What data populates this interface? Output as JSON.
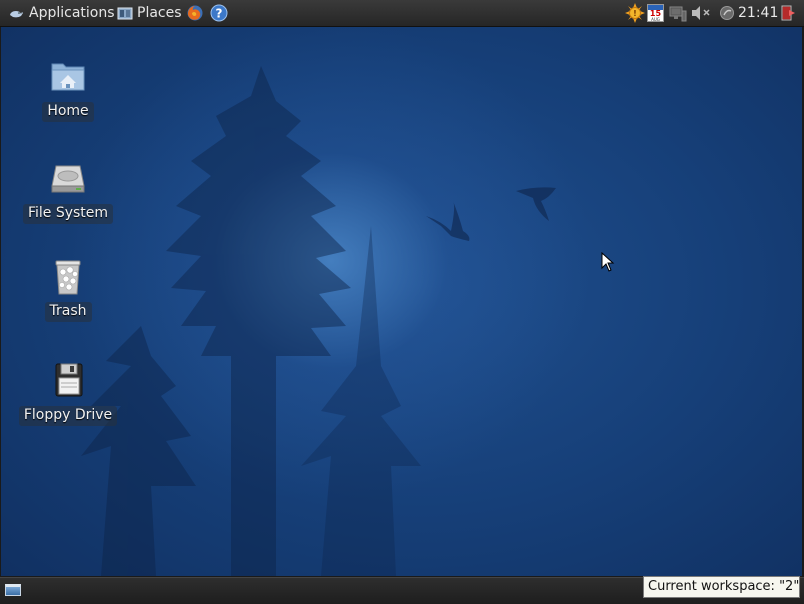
{
  "top_panel": {
    "applications_label": "Applications",
    "places_label": "Places",
    "clock": "21:41",
    "calendar_day": "15",
    "calendar_month": "AUG"
  },
  "desktop_icons": [
    {
      "label": "Home",
      "icon": "home-folder-icon"
    },
    {
      "label": "File System",
      "icon": "hard-drive-icon"
    },
    {
      "label": "Trash",
      "icon": "trash-icon"
    },
    {
      "label": "Floppy Drive",
      "icon": "floppy-icon"
    }
  ],
  "bottom_panel": {
    "workspace_tooltip": "Current workspace: \"2\""
  },
  "colors": {
    "panel_bg": "#2f2f2f",
    "desktop_blue": "#163f78",
    "tooltip_bg": "#f6f6ef"
  }
}
